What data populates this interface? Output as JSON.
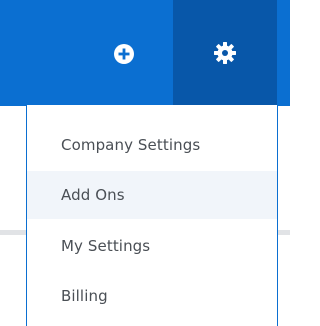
{
  "toolbar": {
    "add_icon": "plus-circle-icon",
    "settings_icon": "gear-icon",
    "bar_color": "#0b6fd1",
    "settings_active_color": "#0857a9"
  },
  "menu": {
    "items": [
      {
        "label": "Company Settings"
      },
      {
        "label": "Add Ons",
        "highlighted": true
      },
      {
        "label": "My Settings"
      },
      {
        "label": "Billing"
      }
    ]
  }
}
